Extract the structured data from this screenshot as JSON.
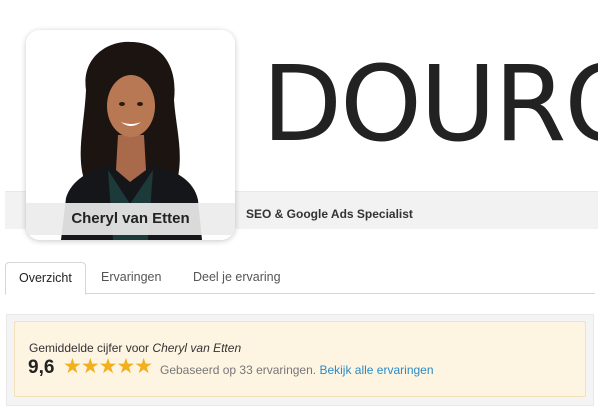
{
  "cover": {
    "brand_logo_text": "DOURO"
  },
  "profile": {
    "name": "Cheryl van Etten",
    "tagline": "SEO & Google Ads Specialist",
    "photo_icon": "person-portrait-icon"
  },
  "tabs": [
    {
      "label": "Overzicht",
      "active": true
    },
    {
      "label": "Ervaringen",
      "active": false
    },
    {
      "label": "Deel je ervaring",
      "active": false
    }
  ],
  "rating": {
    "label_prefix": "Gemiddelde cijfer voor",
    "label_name": "Cheryl van Etten",
    "score": "9,6",
    "stars": 5,
    "star_glyphs": "★★★★★",
    "based_text": "Gebaseerd op 33 ervaringen.",
    "link_text": "Bekijk alle ervaringen"
  },
  "colors": {
    "star": "#f2b01e",
    "link": "#2a8cc7",
    "rating_bg": "#fdf4e2"
  }
}
